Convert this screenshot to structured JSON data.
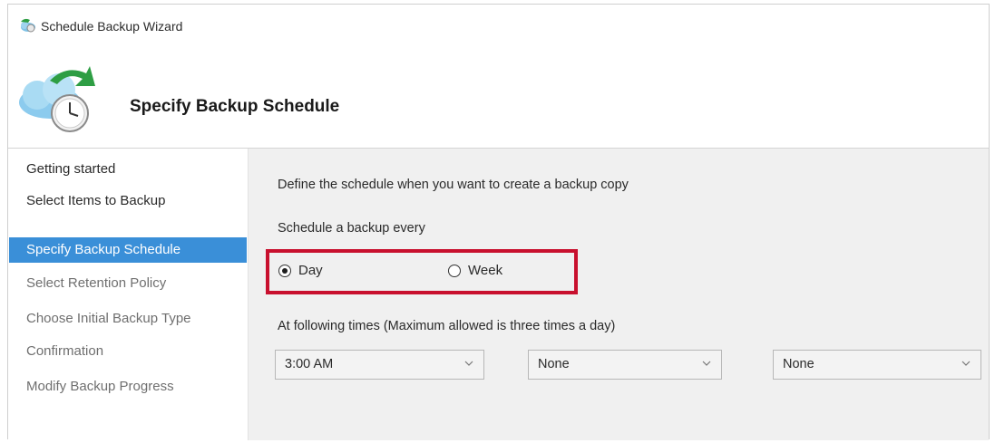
{
  "window": {
    "title": "Schedule Backup Wizard"
  },
  "header": {
    "heading": "Specify Backup Schedule"
  },
  "nav": {
    "items": [
      {
        "label": "Getting started",
        "state": "normal"
      },
      {
        "label": "Select Items to Backup",
        "state": "normal"
      },
      {
        "label": "Specify Backup Schedule",
        "state": "active"
      },
      {
        "label": "Select Retention Policy",
        "state": "dim"
      },
      {
        "label": "Choose Initial Backup Type",
        "state": "dim"
      },
      {
        "label": "Confirmation",
        "state": "dim"
      },
      {
        "label": "Modify Backup Progress",
        "state": "dim"
      }
    ]
  },
  "content": {
    "description": "Define the schedule when you want to create a backup copy",
    "schedule_label": "Schedule a backup every",
    "frequency": {
      "options": [
        {
          "label": "Day",
          "checked": true
        },
        {
          "label": "Week",
          "checked": false
        }
      ]
    },
    "times_label": "At following times (Maximum allowed is three times a day)",
    "times": [
      "3:00 AM",
      "None",
      "None"
    ]
  },
  "colors": {
    "nav_active": "#3a8fd8",
    "highlight_border": "#c8102e",
    "content_bg": "#f0f0f0"
  },
  "icons": {
    "app": "backup-cloud-icon",
    "header": "cloud-clock-arrow-icon",
    "dropdown": "chevron-down-icon"
  }
}
